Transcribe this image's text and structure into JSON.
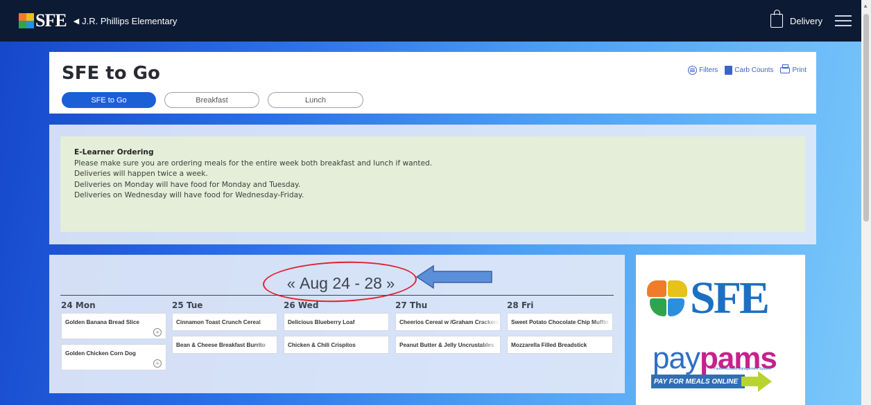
{
  "header": {
    "logo_text": "SFE",
    "school_name": "J.R. Phillips Elementary",
    "delivery_label": "Delivery"
  },
  "page": {
    "title": "SFE to Go",
    "tabs": [
      {
        "label": "SFE to Go",
        "active": true
      },
      {
        "label": "Breakfast",
        "active": false
      },
      {
        "label": "Lunch",
        "active": false
      }
    ],
    "tools": {
      "filters": "Filters",
      "carb_counts": "Carb Counts",
      "print": "Print"
    }
  },
  "notice": {
    "heading": "E-Learner Ordering",
    "lines": [
      "Please make sure you are ordering meals for the entire week both breakfast and lunch if wanted.",
      "Deliveries will happen twice a week.",
      "Deliveries on Monday will have food for Monday and Tuesday.",
      "Deliveries on Wednesday will have food for Wednesday-Friday."
    ]
  },
  "calendar": {
    "prev": "«",
    "next": "»",
    "week_label": "Aug 24 - 28",
    "days": [
      {
        "label": "24 Mon",
        "meals": [
          "Golden Banana Bread Slice",
          "Golden Chicken Corn Dog"
        ]
      },
      {
        "label": "25 Tue",
        "meals": [
          "Cinnamon Toast Crunch Cereal",
          "Bean & Cheese Breakfast Burrito"
        ]
      },
      {
        "label": "26 Wed",
        "meals": [
          "Delicious Blueberry Loaf",
          "Chicken & Chili Crispitos"
        ]
      },
      {
        "label": "27 Thu",
        "meals": [
          "Cheerios Cereal w /Graham Crackers",
          "Peanut Butter & Jelly Uncrustables"
        ]
      },
      {
        "label": "28 Fri",
        "meals": [
          "Sweet Potato Chocolate Chip Muffin",
          "Mozzarella Filled Breadstick"
        ]
      }
    ]
  },
  "ad": {
    "logo": "SFE",
    "pay": "pay",
    "pams": "pams",
    "subtitle": "Parent Account Management System",
    "banner": "PAY FOR MEALS ONLINE"
  },
  "colors": {
    "topbar": "#0d1a33",
    "accent": "#1b5fd6",
    "annotation": "#e0202a",
    "notice_bg": "#e5eed8"
  }
}
